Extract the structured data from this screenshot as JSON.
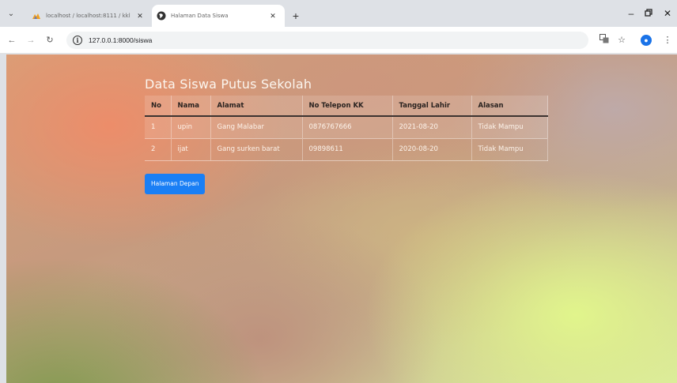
{
  "tabs": [
    {
      "title": "localhost / localhost:8111 / kkl",
      "active": false,
      "favicon": "phpmyadmin-icon"
    },
    {
      "title": "Halaman Data Siswa",
      "active": true,
      "favicon": "globe-icon"
    }
  ],
  "address_bar": {
    "url": "127.0.0.1:8000/siswa"
  },
  "page": {
    "title": "Data Siswa Putus Sekolah",
    "columns": [
      "No",
      "Nama",
      "Alamat",
      "No Telepon KK",
      "Tanggal Lahir",
      "Alasan"
    ],
    "rows": [
      {
        "no": "1",
        "nama": "upin",
        "alamat": "Gang Malabar",
        "telepon": "0876767666",
        "tanggal_lahir": "2021-08-20",
        "alasan": "Tidak Mampu"
      },
      {
        "no": "2",
        "nama": "ijat",
        "alamat": "Gang surken barat",
        "telepon": "09898611",
        "tanggal_lahir": "2020-08-20",
        "alasan": "Tidak Mampu"
      }
    ],
    "home_button": "Halaman Depan"
  },
  "colors": {
    "button": "#1a7ff5",
    "title_text": "#fbf5ee"
  }
}
